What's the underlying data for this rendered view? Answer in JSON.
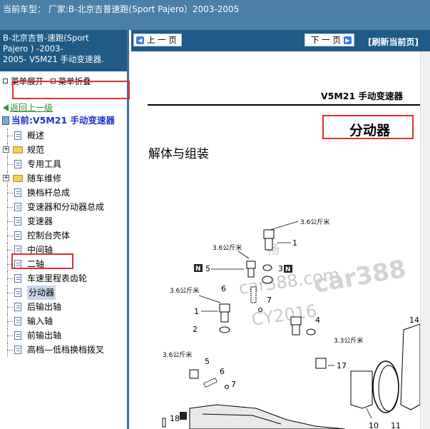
{
  "topbar": {
    "title": "当前车型：  厂家:B-北京吉普速跑(Sport Pajero）2003-2005"
  },
  "sidebar": {
    "header_line1": "B-北京吉普-速跑(Sport",
    "header_line2": "Pajero ) -2003-",
    "header_line3": "2005- V5M21 手动变速器.",
    "expand_label": "菜单展开",
    "collapse_label": "菜单折叠",
    "back_label": "返回上一级",
    "current_label": "当前:V5M21 手动变速器",
    "items": [
      {
        "label": "概述",
        "type": "doc"
      },
      {
        "label": "规范",
        "type": "folder"
      },
      {
        "label": "专用工具",
        "type": "doc"
      },
      {
        "label": "随车维修",
        "type": "folder"
      },
      {
        "label": "换档杆总成",
        "type": "doc"
      },
      {
        "label": "变速器和分动器总成",
        "type": "doc"
      },
      {
        "label": "变速器",
        "type": "doc"
      },
      {
        "label": "控制台壳体",
        "type": "doc"
      },
      {
        "label": "中间轴",
        "type": "doc"
      },
      {
        "label": "二轴",
        "type": "doc"
      },
      {
        "label": "车速里程表齿轮",
        "type": "doc"
      },
      {
        "label": "分动器",
        "type": "doc",
        "selected": true
      },
      {
        "label": "后输出轴",
        "type": "doc"
      },
      {
        "label": "输入轴",
        "type": "doc"
      },
      {
        "label": "前输出轴",
        "type": "doc"
      },
      {
        "label": "高档—低档换档拨叉",
        "type": "doc"
      }
    ]
  },
  "nav": {
    "prev_label": "上 一 页",
    "next_label": "下 一 页",
    "refresh_label": "[刷新当前页]"
  },
  "document": {
    "header": "V5M21 手动变速器",
    "section_title": "分动器",
    "subtitle": "解体与组装",
    "diagram": {
      "torque_label": "3.6公斤米",
      "torque_label_2": "3.3公斤米",
      "n_mark": "N",
      "callouts": [
        "1",
        "2",
        "3",
        "4",
        "5",
        "6",
        "7",
        "10",
        "11",
        "14",
        "17",
        "18"
      ],
      "watermark_1": "畅",
      "watermark_2": "car388.com",
      "watermark_3": "CY2016",
      "watermark_4": "car388"
    }
  }
}
